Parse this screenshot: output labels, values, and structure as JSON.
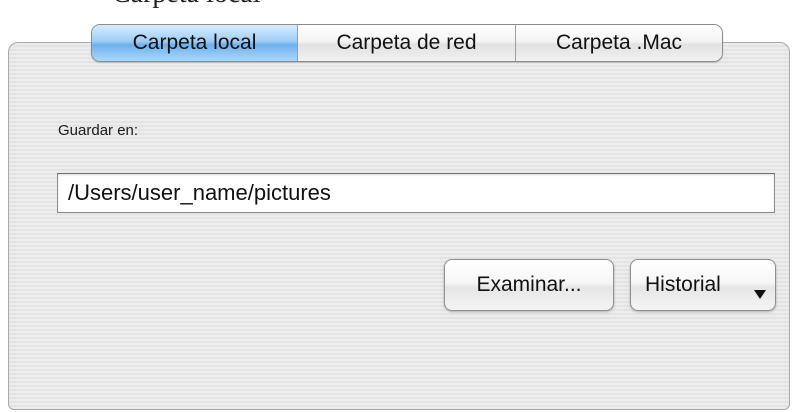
{
  "header_fragment": "Carpeta local",
  "tabs": [
    {
      "label": "Carpeta local",
      "selected": true
    },
    {
      "label": "Carpeta de red",
      "selected": false
    },
    {
      "label": "Carpeta .Mac",
      "selected": false
    }
  ],
  "save_location": {
    "label": "Guardar en:",
    "value": "/Users/user_name/pictures"
  },
  "buttons": {
    "browse_label": "Examinar...",
    "history_label": "Historial"
  },
  "icons": {
    "history_dropdown": "triangle-down-icon"
  },
  "colors": {
    "active_tab": "#7fbdf0",
    "panel_background": "#e8e8e8"
  }
}
